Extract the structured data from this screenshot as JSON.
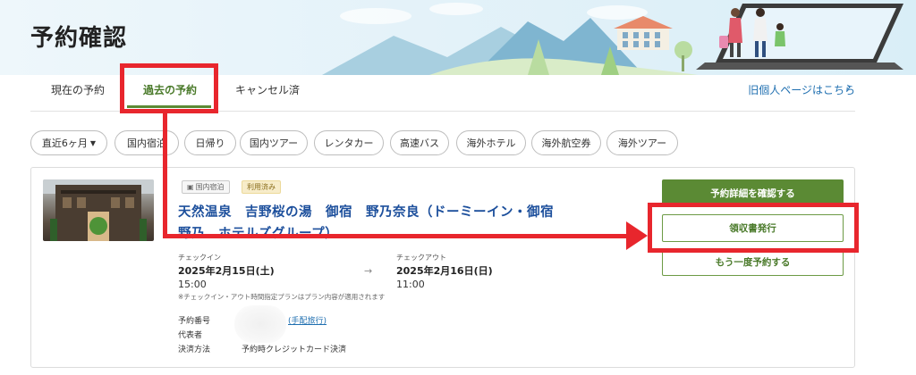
{
  "page": {
    "title": "予約確認"
  },
  "tabs": [
    {
      "label": "現在の予約"
    },
    {
      "label": "過去の予約"
    },
    {
      "label": "キャンセル済"
    }
  ],
  "old_page_link": "旧個人ページはこちら",
  "filters": {
    "period": "直近6ヶ月",
    "chips": [
      "国内宿泊",
      "日帰り",
      "国内ツアー",
      "レンタカー",
      "高速バス",
      "海外ホテル",
      "海外航空券",
      "海外ツアー"
    ]
  },
  "reservation": {
    "badge_category": "国内宿泊",
    "badge_status": "利用済み",
    "hotel_name_line1": "天然温泉　吉野桜の湯　御宿　野乃奈良（ドーミーイン・御宿",
    "hotel_name_line2": "野乃　ホテルズグループ）",
    "checkin_label": "チェックイン",
    "checkin_date": "2025年2月15日(土)",
    "checkin_time": "15:00",
    "arrow": "→",
    "checkout_label": "チェックアウト",
    "checkout_date": "2025年2月16日(日)",
    "checkout_time": "11:00",
    "note": "※チェックイン・アウト時間指定プランはプラン内容が適用されます",
    "booking_number_label": "予約番号",
    "arrange_link": "手配旅行",
    "representative_label": "代表者",
    "payment_label": "決済方法",
    "payment_value": "予約時クレジットカード決済"
  },
  "buttons": {
    "detail": "予約詳細を確認する",
    "receipt": "領収書発行",
    "rebook": "もう一度予約する"
  },
  "colors": {
    "accent_green": "#5b8a34",
    "link_blue": "#1f6fb0",
    "hotel_blue": "#1c4f9c",
    "annotation_red": "#e8262d"
  }
}
